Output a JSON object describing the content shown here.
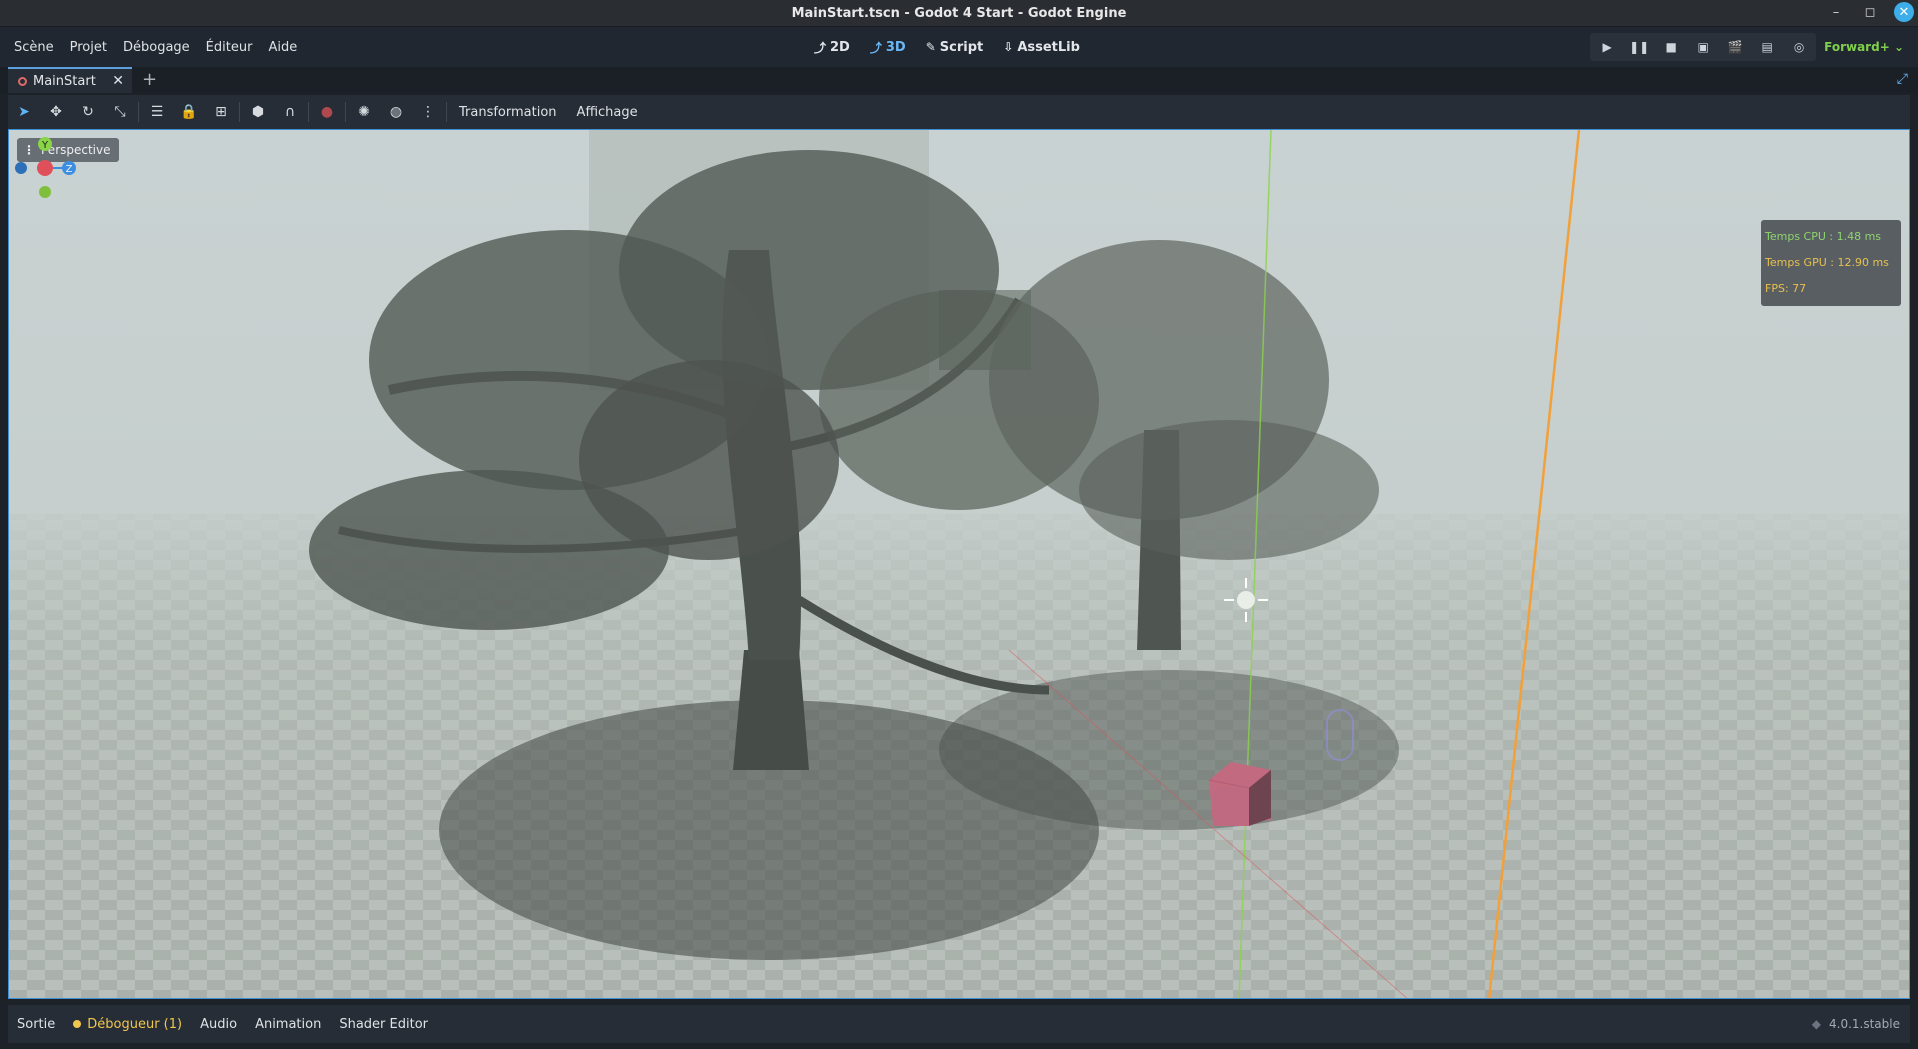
{
  "window": {
    "title": "MainStart.tscn - Godot 4 Start - Godot Engine",
    "controls": {
      "minimize": "–",
      "maximize": "◻",
      "close": "✕"
    }
  },
  "menu": {
    "items": [
      "Scène",
      "Projet",
      "Débogage",
      "Éditeur",
      "Aide"
    ]
  },
  "main_screens": {
    "items": [
      {
        "label": "2D",
        "icon": "2d-icon"
      },
      {
        "label": "3D",
        "icon": "3d-icon",
        "active": true
      },
      {
        "label": "Script",
        "icon": "script-icon"
      },
      {
        "label": "AssetLib",
        "icon": "assetlib-icon"
      }
    ]
  },
  "run_bar": {
    "renderer": "Forward+",
    "icons": [
      "play-icon",
      "pause-icon",
      "stop-icon",
      "remote-debug-icon",
      "play-scene-icon",
      "play-custom-icon",
      "movie-maker-icon"
    ]
  },
  "scene_tabs": {
    "tabs": [
      {
        "label": "MainStart"
      }
    ],
    "add_symbol": "+"
  },
  "toolbar": {
    "transform_menu": "Transformation",
    "view_menu": "Affichage",
    "icons": [
      "select-icon",
      "move-icon",
      "rotate-icon",
      "scale-icon",
      "list-select-icon",
      "lock-icon",
      "group-icon",
      "snap-icon",
      "local-space-icon",
      "use-snap-icon",
      "camera-override-icon",
      "sun-icon",
      "environment-icon",
      "more-icon"
    ]
  },
  "viewport": {
    "perspective_label": "Perspective",
    "gizmo": {
      "y_label": "Y",
      "z_label": "Z"
    },
    "stats": {
      "cpu": "Temps CPU : 1.48 ms",
      "gpu": "Temps GPU : 12.90 ms",
      "fps": "FPS: 77"
    }
  },
  "bottom_panel": {
    "tabs": [
      {
        "label": "Sortie"
      },
      {
        "label": "Débogueur (1)",
        "warning": true
      },
      {
        "label": "Audio"
      },
      {
        "label": "Animation"
      },
      {
        "label": "Shader Editor"
      }
    ],
    "version": "4.0.1.stable"
  },
  "colors": {
    "accent": "#5fb2f5",
    "renderer": "#7fcf4c",
    "warning": "#f0c64e",
    "axis_y": "#8ad448",
    "axis_x": "#e0505a",
    "axis_z": "#3b8ee0"
  }
}
